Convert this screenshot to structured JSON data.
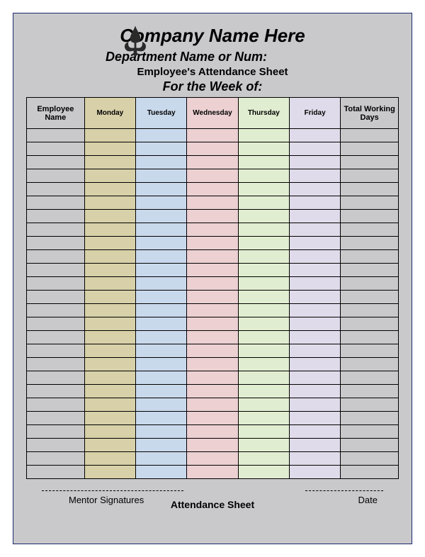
{
  "header": {
    "company": "Company Name Here",
    "department": "Department Name or Num:",
    "employee_line": "Employee's Attendance Sheet",
    "week": "For the Week of:"
  },
  "columns": {
    "employee": "Employee Name",
    "days": [
      "Monday",
      "Tuesday",
      "Wednesday",
      "Thursday",
      "Friday"
    ],
    "total": "Total Working Days"
  },
  "row_count": 26,
  "footer": {
    "mentor": "Mentor Signatures",
    "attendance": "Attendance Sheet",
    "date": "Date"
  },
  "colors": {
    "monday": "#d8d0a8",
    "tuesday": "#c9d9ec",
    "wednesday": "#ecd0d2",
    "thursday": "#e1edd0",
    "friday": "#e0dbea",
    "plain": "#c9c8cb"
  }
}
